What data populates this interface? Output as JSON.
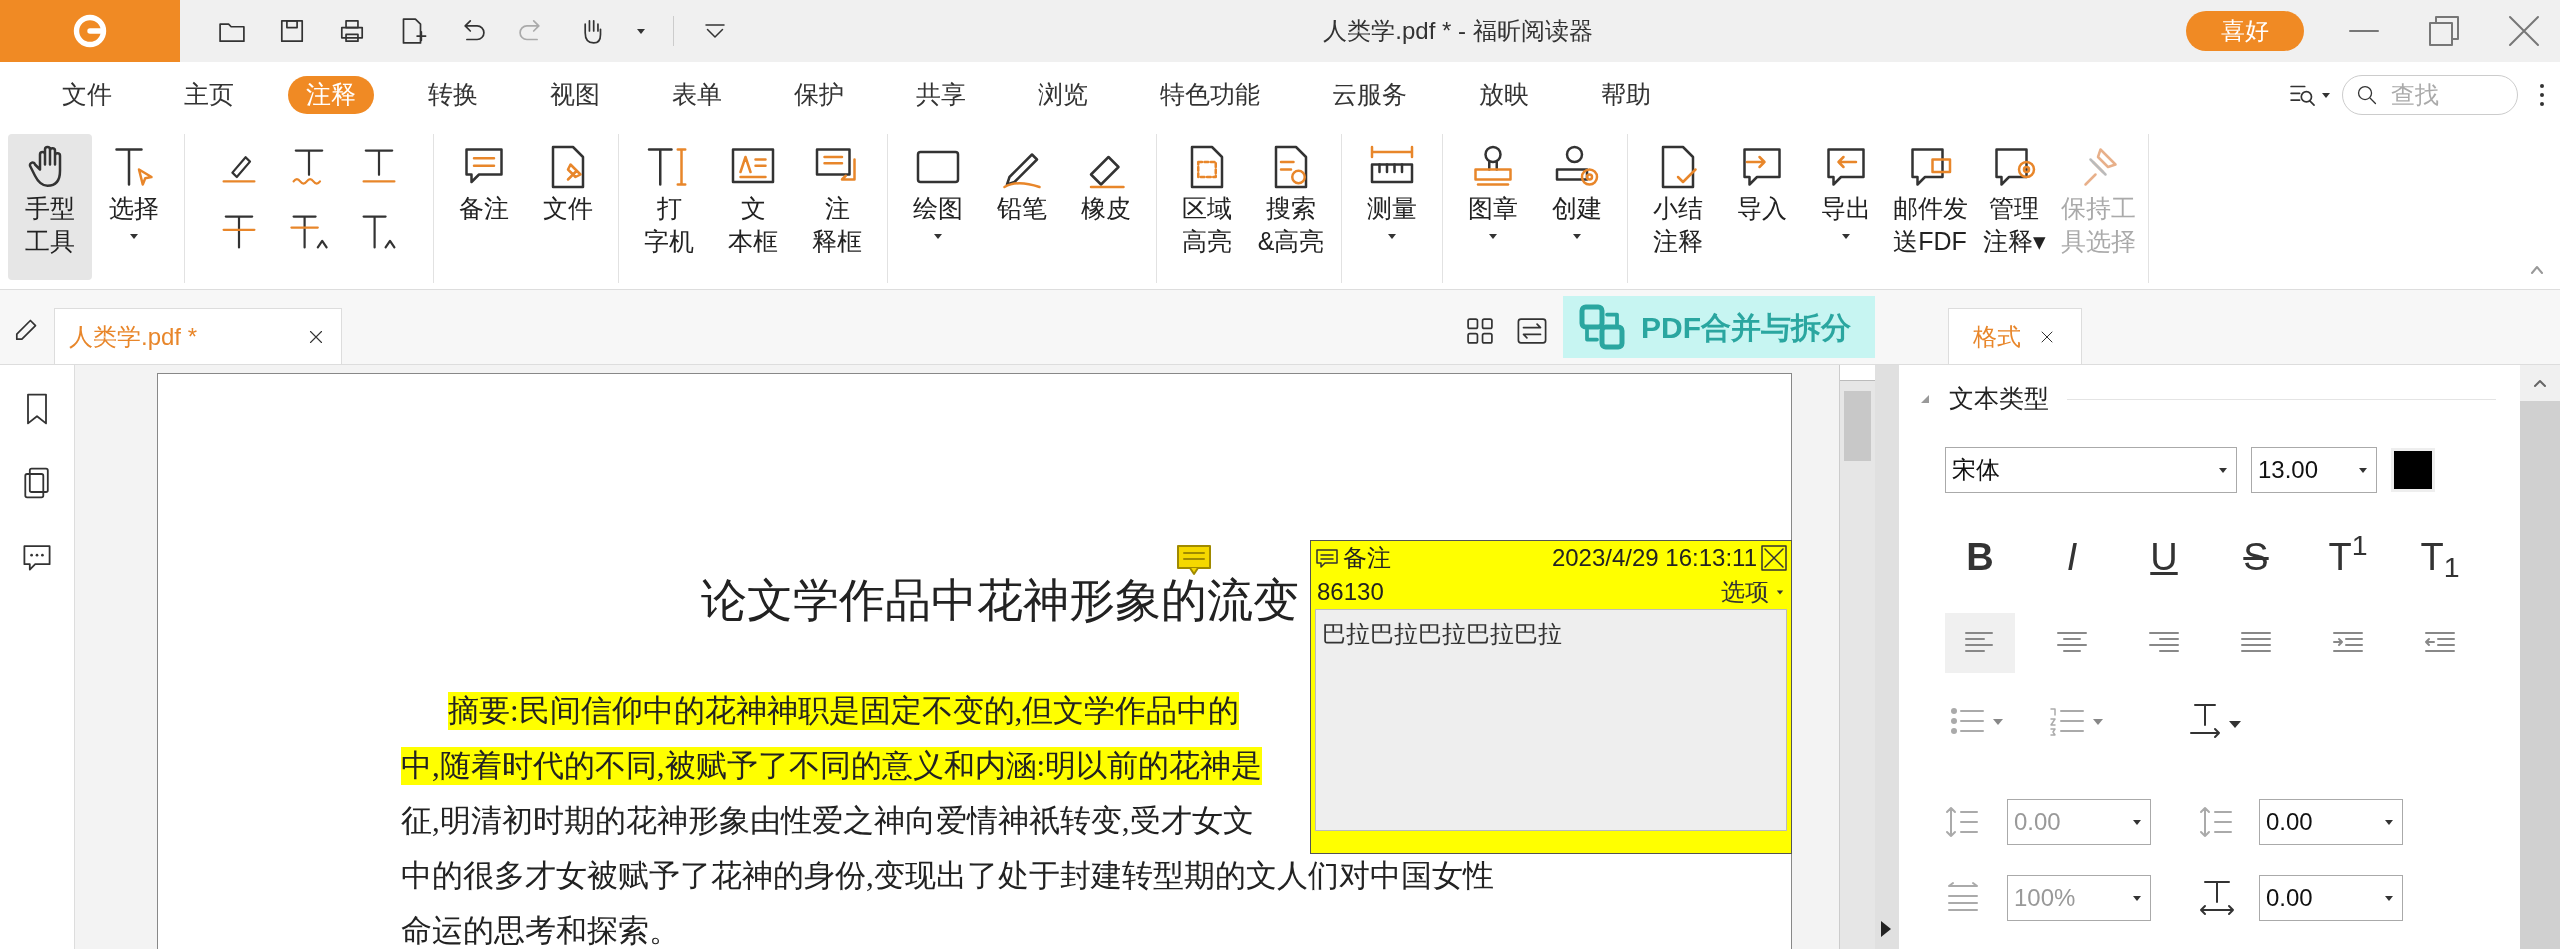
{
  "window": {
    "title": "人类学.pdf * - 福昕阅读器",
    "like_button": "喜好"
  },
  "menu": [
    {
      "label": "文件",
      "selected": false
    },
    {
      "label": "主页",
      "selected": false
    },
    {
      "label": "注释",
      "selected": true
    },
    {
      "label": "转换",
      "selected": false
    },
    {
      "label": "视图",
      "selected": false
    },
    {
      "label": "表单",
      "selected": false
    },
    {
      "label": "保护",
      "selected": false
    },
    {
      "label": "共享",
      "selected": false
    },
    {
      "label": "浏览",
      "selected": false
    },
    {
      "label": "特色功能",
      "selected": false
    },
    {
      "label": "云服务",
      "selected": false
    },
    {
      "label": "放映",
      "selected": false
    },
    {
      "label": "帮助",
      "selected": false
    }
  ],
  "search": {
    "placeholder": "查找"
  },
  "ribbon": {
    "groups": [
      {
        "kind": "tools",
        "items": [
          {
            "lines": [
              "手型",
              "工具"
            ],
            "selected": true,
            "dropdown": false,
            "disabled": false
          },
          {
            "lines": [
              "选择"
            ],
            "selected": false,
            "dropdown": true,
            "disabled": false
          }
        ]
      },
      {
        "kind": "grid"
      },
      {
        "kind": "tools",
        "items": [
          {
            "lines": [
              "备注"
            ],
            "selected": false,
            "dropdown": false,
            "disabled": false
          },
          {
            "lines": [
              "文件"
            ],
            "selected": false,
            "dropdown": false,
            "disabled": false
          }
        ]
      },
      {
        "kind": "tools",
        "items": [
          {
            "lines": [
              "打",
              "字机"
            ],
            "selected": false,
            "dropdown": false,
            "disabled": false
          },
          {
            "lines": [
              "文",
              "本框"
            ],
            "selected": false,
            "dropdown": false,
            "disabled": false
          },
          {
            "lines": [
              "注",
              "释框"
            ],
            "selected": false,
            "dropdown": false,
            "disabled": false
          }
        ]
      },
      {
        "kind": "tools",
        "items": [
          {
            "lines": [
              "绘图"
            ],
            "selected": false,
            "dropdown": true,
            "disabled": false
          },
          {
            "lines": [
              "铅笔"
            ],
            "selected": false,
            "dropdown": false,
            "disabled": false
          },
          {
            "lines": [
              "橡皮"
            ],
            "selected": false,
            "dropdown": false,
            "disabled": false
          }
        ]
      },
      {
        "kind": "tools",
        "items": [
          {
            "lines": [
              "区域",
              "高亮"
            ],
            "selected": false,
            "dropdown": false,
            "disabled": false
          },
          {
            "lines": [
              "搜索",
              "&高亮"
            ],
            "selected": false,
            "dropdown": false,
            "disabled": false
          }
        ]
      },
      {
        "kind": "tools",
        "items": [
          {
            "lines": [
              "测量"
            ],
            "selected": false,
            "dropdown": true,
            "disabled": false
          }
        ]
      },
      {
        "kind": "tools",
        "items": [
          {
            "lines": [
              "图章"
            ],
            "selected": false,
            "dropdown": true,
            "disabled": false
          },
          {
            "lines": [
              "创建"
            ],
            "selected": false,
            "dropdown": true,
            "disabled": false
          }
        ]
      },
      {
        "kind": "tools",
        "items": [
          {
            "lines": [
              "小结",
              "注释"
            ],
            "selected": false,
            "dropdown": false,
            "disabled": false
          },
          {
            "lines": [
              "导入"
            ],
            "selected": false,
            "dropdown": false,
            "disabled": false
          },
          {
            "lines": [
              "导出"
            ],
            "selected": false,
            "dropdown": true,
            "disabled": false
          },
          {
            "lines": [
              "邮件发",
              "送FDF"
            ],
            "selected": false,
            "dropdown": false,
            "disabled": false
          },
          {
            "lines": [
              "管理",
              "注释▾"
            ],
            "selected": false,
            "dropdown": false,
            "disabled": false
          },
          {
            "lines": [
              "保持工",
              "具选择"
            ],
            "selected": false,
            "dropdown": false,
            "disabled": true
          }
        ]
      }
    ]
  },
  "doc_tabs": [
    {
      "label": "人类学.pdf *",
      "selected": true
    }
  ],
  "promo_banner": "PDF合并与拆分",
  "panel_tabs": [
    {
      "label": "格式",
      "selected": true
    }
  ],
  "document": {
    "title": "论文学作品中花神形象的流变",
    "lines": [
      {
        "text": "摘要:民间信仰中的花神神职是固定不变的,但文学作品中的",
        "highlighted": true,
        "indent": true
      },
      {
        "text": "中,随着时代的不同,被赋予了不同的意义和内涵:明以前的花神是",
        "highlighted": true
      },
      {
        "text": "征,明清初时期的花神形象由性爱之神向爱情神祇转变,受才女文",
        "highlighted": false
      },
      {
        "text": "中的很多才女被赋予了花神的身份,变现出了处于封建转型期的文人们对中国女性",
        "highlighted": false
      },
      {
        "text": "命运的思考和探索。",
        "highlighted": false
      }
    ]
  },
  "note": {
    "title": "备注",
    "date": "2023/4/29 16:13:11",
    "author": "86130",
    "options": "选项",
    "content": "巴拉巴拉巴拉巴拉巴拉"
  },
  "format_panel": {
    "section": "文本类型",
    "font": "宋体",
    "size": "13.00",
    "color": "#000000",
    "style_buttons": [
      {
        "label": "B",
        "kind": "bold"
      },
      {
        "label": "I",
        "kind": "italic"
      },
      {
        "label": "U",
        "kind": "underline"
      },
      {
        "label": "S",
        "kind": "strike"
      },
      {
        "label": "T$^{1}$",
        "kind": "plain"
      },
      {
        "label": "T$_{1}$",
        "kind": "plain"
      }
    ],
    "align_buttons": [
      {
        "selected": true
      },
      {
        "selected": false
      },
      {
        "selected": false
      },
      {
        "selected": false
      },
      {
        "selected": false
      },
      {
        "selected": false
      }
    ],
    "spacing_rows": [
      [
        {
          "value": "0.00",
          "disabled": true
        },
        {
          "value": "0.00",
          "disabled": false
        }
      ],
      [
        {
          "value": "100%",
          "disabled": true
        },
        {
          "value": "0.00",
          "disabled": false
        }
      ]
    ]
  }
}
